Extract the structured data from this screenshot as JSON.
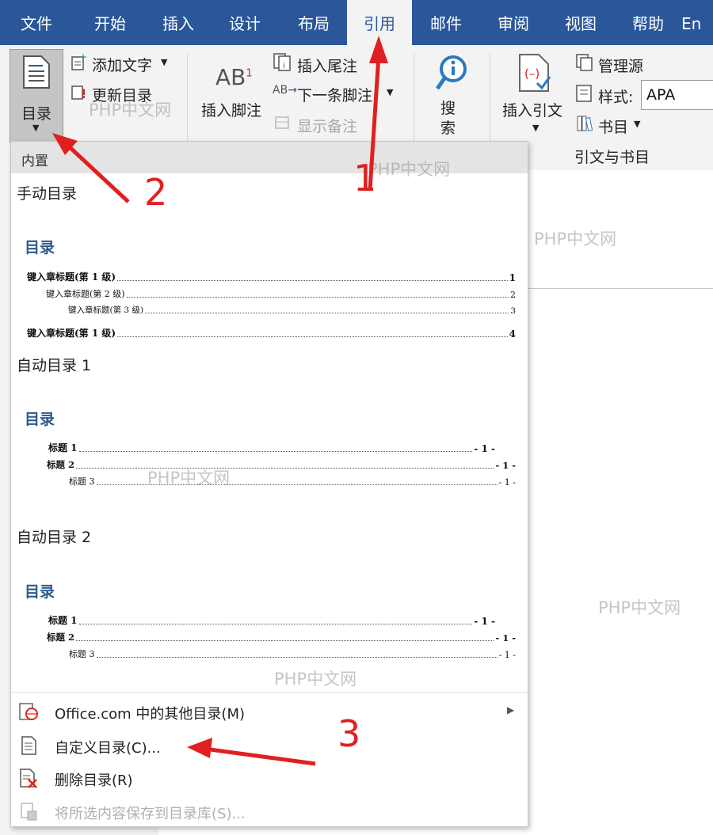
{
  "tabs": [
    "文件",
    "开始",
    "插入",
    "设计",
    "布局",
    "引用",
    "邮件",
    "审阅",
    "视图",
    "帮助",
    "En"
  ],
  "ribbon": {
    "toc_label": "目录",
    "add_text": "添加文字",
    "update_toc": "更新目录",
    "insert_footnote": "插入脚注",
    "insert_endnote": "插入尾注",
    "next_footnote": "下一条脚注",
    "show_notes": "显示备注",
    "search": "搜索",
    "insert_citation": "插入引文",
    "manage_sources": "管理源",
    "style_label": "样式:",
    "style_value": "APA",
    "bibliography": "书目",
    "group_citations": "引文与书目"
  },
  "menu": {
    "header": "内置",
    "manual": {
      "name": "手动目录",
      "preview_title": "目录",
      "rows": [
        {
          "text": "键入章标题(第 1 级)",
          "page": "1"
        },
        {
          "text": "键入章标题(第 2 级)",
          "page": "2"
        },
        {
          "text": "键入章标题(第 3 级)",
          "page": "3"
        },
        {
          "text": "键入章标题(第 1 级)",
          "page": "4"
        }
      ]
    },
    "auto1": {
      "name": "自动目录 1",
      "preview_title": "目录",
      "rows": [
        {
          "text": "标题 1",
          "page": "- 1 -"
        },
        {
          "text": "标题 2",
          "page": "- 1 -"
        },
        {
          "text": "标题 3",
          "page": "- 1 -"
        }
      ]
    },
    "auto2": {
      "name": "自动目录 2",
      "preview_title": "目录",
      "rows": [
        {
          "text": "标题 1",
          "page": "- 1 -"
        },
        {
          "text": "标题 2",
          "page": "- 1 -"
        },
        {
          "text": "标题 3",
          "page": "- 1 -"
        }
      ]
    },
    "items": [
      {
        "label": "Office.com 中的其他目录(M)",
        "enabled": true,
        "has_submenu": true
      },
      {
        "label": "自定义目录(C)...",
        "enabled": true
      },
      {
        "label": "删除目录(R)",
        "enabled": true
      },
      {
        "label": "将所选内容保存到目录库(S)...",
        "enabled": false
      }
    ]
  },
  "watermark": "PHP中文网",
  "annotations": [
    "1",
    "2",
    "3"
  ],
  "colors": {
    "ribbon_blue": "#2b579a",
    "arrow_red": "#e02020",
    "toc_blue": "#2e5a8c"
  }
}
